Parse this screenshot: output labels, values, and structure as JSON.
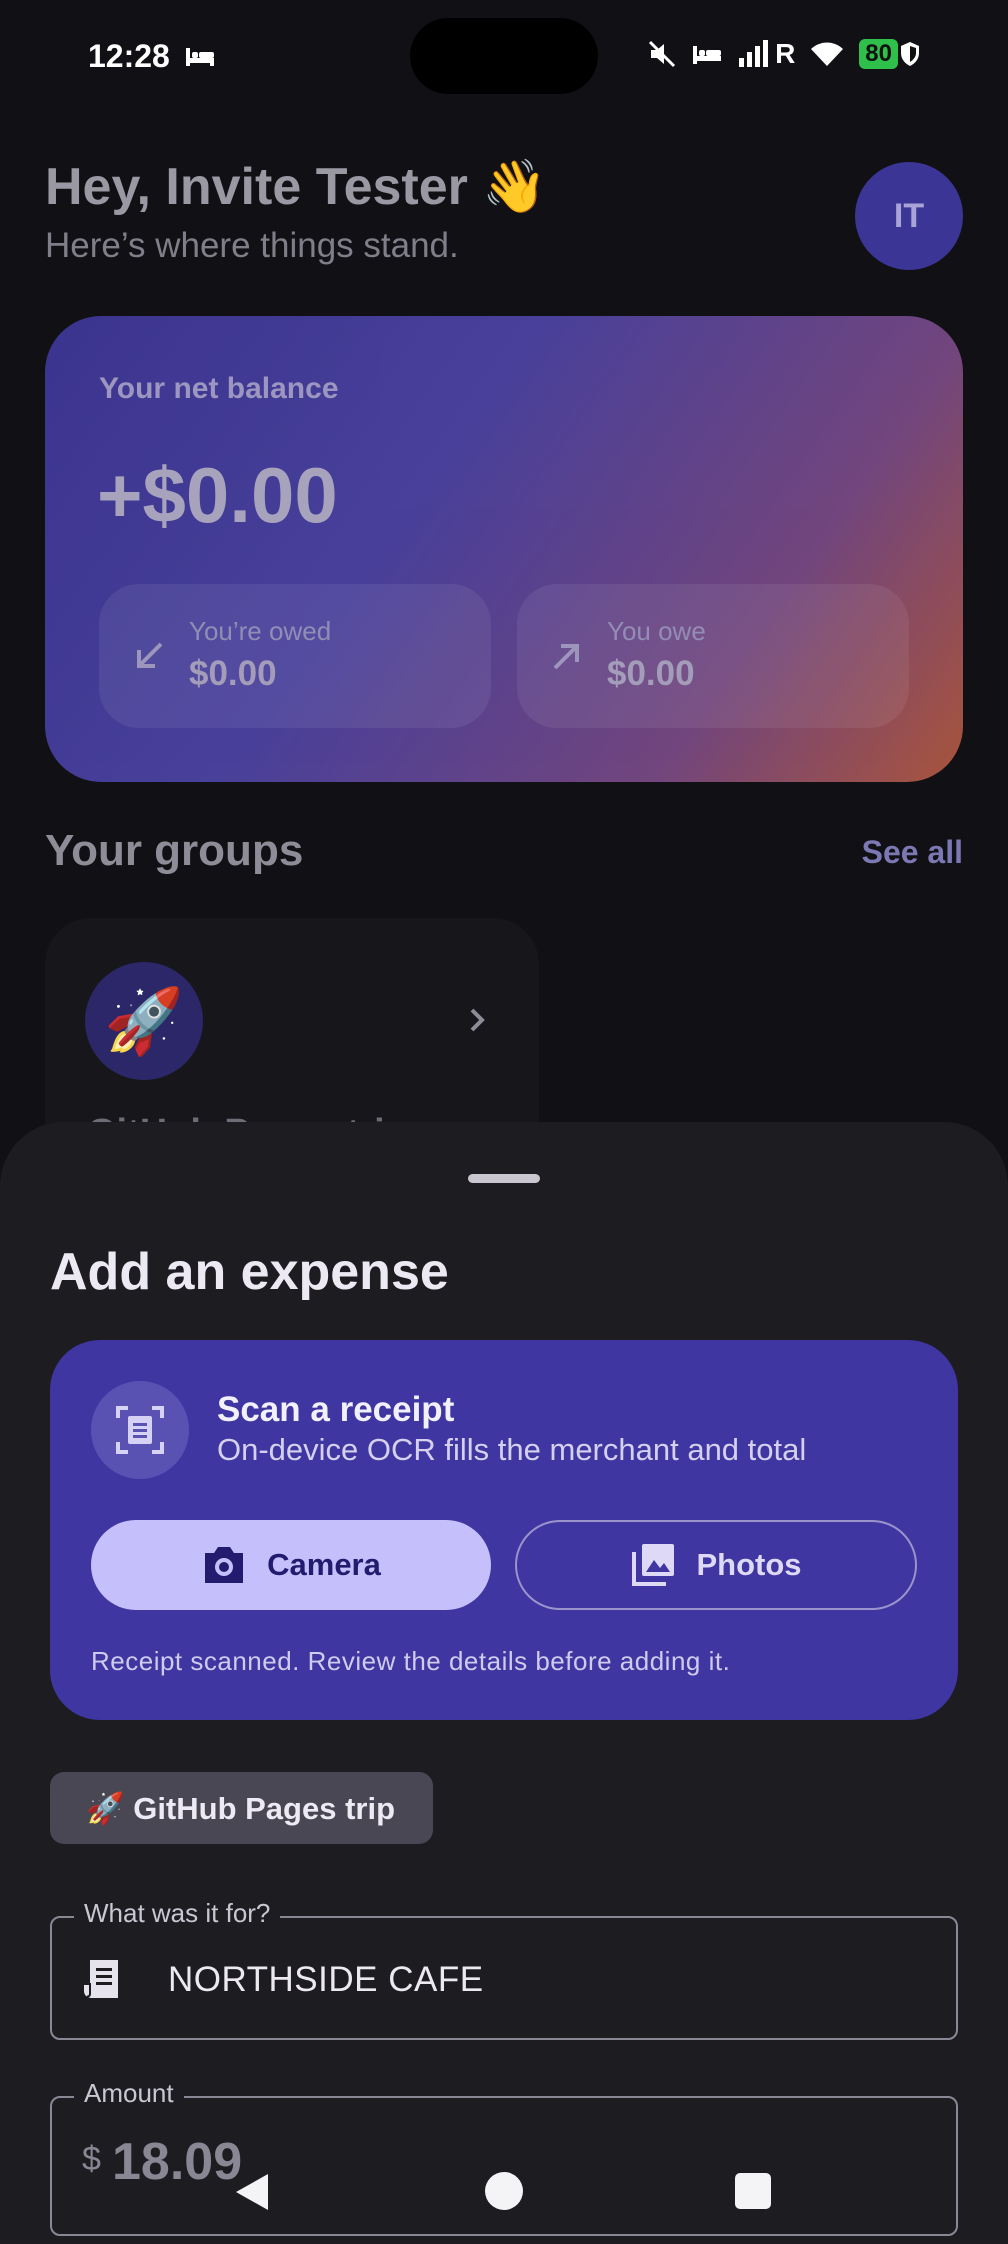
{
  "status_bar": {
    "time": "12:28",
    "battery": "80",
    "network_letter": "R",
    "icons": [
      "bed-icon",
      "mute-icon",
      "bed-icon",
      "signal-icon",
      "wifi-icon",
      "battery-icon",
      "shield-icon"
    ]
  },
  "dashboard": {
    "greeting": "Hey, Invite Tester 👋",
    "subgreeting": "Here’s where things stand.",
    "avatar_initials": "IT",
    "balance": {
      "label": "Your net balance",
      "amount": "+$0.00",
      "owed_label": "You’re owed",
      "owed_value": "$0.00",
      "owe_label": "You owe",
      "owe_value": "$0.00"
    },
    "groups_title": "Your groups",
    "see_all": "See all",
    "group": {
      "emoji": "🚀",
      "name": "GitHub Pages trip"
    }
  },
  "sheet": {
    "title": "Add an expense",
    "scan": {
      "title": "Scan a receipt",
      "subtitle": "On-device OCR fills the merchant and total",
      "camera_label": "Camera",
      "photos_label": "Photos",
      "status": "Receipt scanned. Review the details before adding it."
    },
    "group_chip": "🚀 GitHub Pages trip",
    "description_field": {
      "label": "What was it for?",
      "value": "NORTHSIDE CAFE"
    },
    "amount_field": {
      "label": "Amount",
      "currency": "$",
      "value": "18.09"
    }
  },
  "colors": {
    "background": "#111014",
    "sheet": "#1d1c21",
    "scan_card": "#3f36a1",
    "camera_button": "#c5c0fb",
    "avatar": "#3b3596"
  }
}
